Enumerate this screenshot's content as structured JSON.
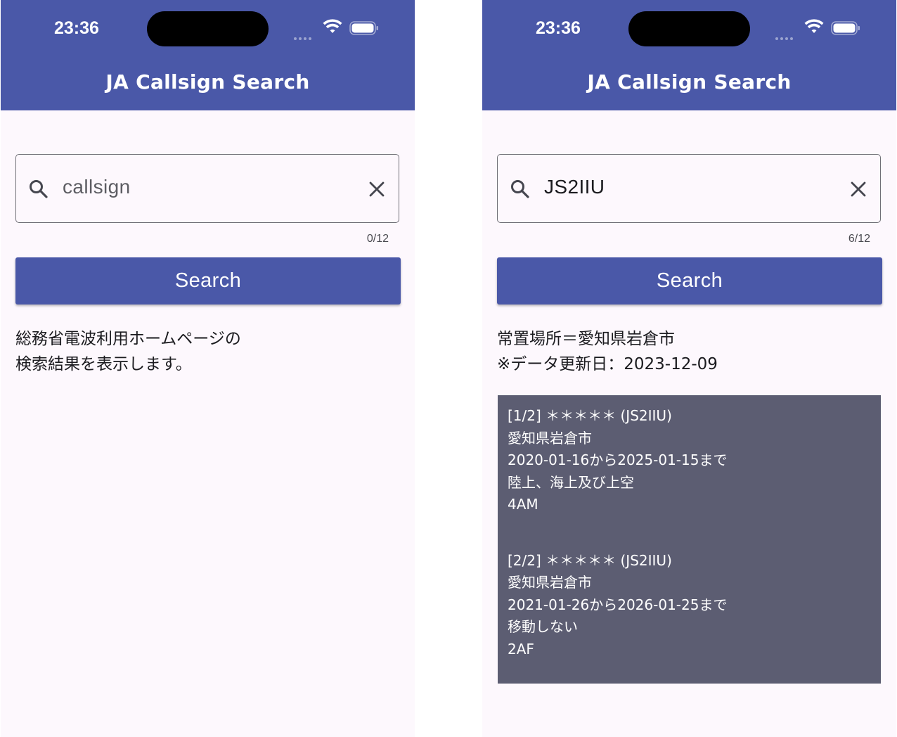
{
  "status_bar": {
    "time": "23:36"
  },
  "app_bar": {
    "title": "JA Callsign Search"
  },
  "left_screen": {
    "search": {
      "placeholder": "callsign",
      "value": ""
    },
    "counter": "0/12",
    "search_button_label": "Search",
    "info_line1": "総務省電波利用ホームページの",
    "info_line2": "検索結果を表示します。"
  },
  "right_screen": {
    "search": {
      "placeholder": "callsign",
      "value": "JS2IIU"
    },
    "counter": "6/12",
    "search_button_label": "Search",
    "result_line1": "常置場所＝愛知県岩倉市",
    "result_line2": "※データ更新日：2023-12-09",
    "records": [
      {
        "header": "[1/2] ＊＊＊＊＊ (JS2IIU)",
        "location": "愛知県岩倉市",
        "period": "2020-01-16から2025-01-15まで",
        "area": "陸上、海上及び上空",
        "station_class": "4AM"
      },
      {
        "header": "[2/2] ＊＊＊＊＊ (JS2IIU)",
        "location": "愛知県岩倉市",
        "period": "2021-01-26から2026-01-25まで",
        "area": "移動しない",
        "station_class": "2AF"
      }
    ]
  },
  "colors": {
    "primary": "#4a58a8",
    "background": "#fdf8fd",
    "result_panel": "#5c5d72",
    "on_primary": "#ffffff"
  },
  "icons": [
    "search-icon",
    "close-icon",
    "wifi-icon",
    "battery-icon"
  ]
}
